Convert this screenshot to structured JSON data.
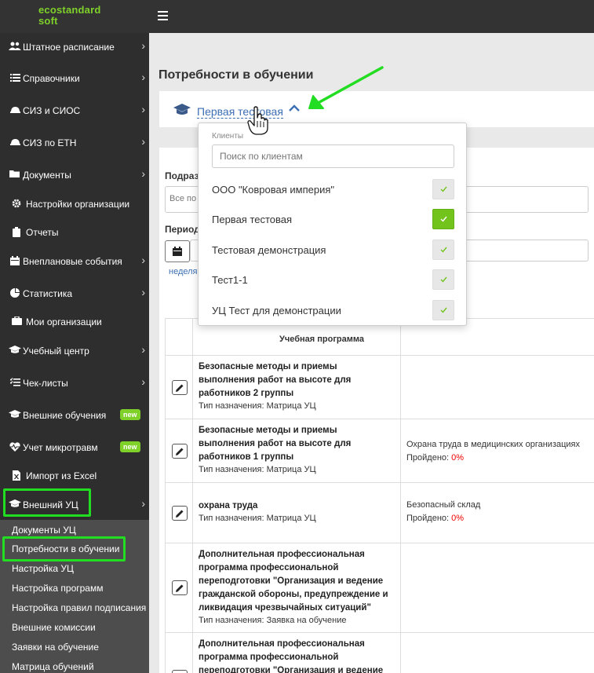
{
  "app": {
    "logo_line1": "ecostandard",
    "logo_line2": "soft"
  },
  "sidebar": {
    "items": [
      {
        "label": "Штатное расписание",
        "icon": "users-icon",
        "chevron": true
      },
      {
        "label": "Справочники",
        "icon": "list-icon",
        "chevron": true
      },
      {
        "label": "СИЗ и СИОС",
        "icon": "hard-hat-icon",
        "chevron": true
      },
      {
        "label": "СИЗ по ЕТН",
        "icon": "hard-hat-icon",
        "chevron": true
      },
      {
        "label": "Документы",
        "icon": "folder-icon",
        "chevron": true
      },
      {
        "label": "Настройки организации",
        "icon": "gear-icon",
        "chevron": false
      },
      {
        "label": "Отчеты",
        "icon": "clipboard-icon",
        "chevron": false
      },
      {
        "label": "Внеплановые события",
        "icon": "calendar-icon",
        "chevron": true
      },
      {
        "label": "Статистика",
        "icon": "pie-chart-icon",
        "chevron": true
      },
      {
        "label": "Мои организации",
        "icon": "briefcase-icon",
        "chevron": false
      },
      {
        "label": "Учебный центр",
        "icon": "graduation-cap-icon",
        "chevron": true
      },
      {
        "label": "Чек-листы",
        "icon": "checklist-icon",
        "chevron": true
      },
      {
        "label": "Внешние обучения",
        "icon": "graduation-cap-icon",
        "badge": "new"
      },
      {
        "label": "Учет микротравм",
        "icon": "heartbeat-icon",
        "badge": "new"
      },
      {
        "label": "Импорт из Excel",
        "icon": "excel-file-icon",
        "chevron": false
      },
      {
        "label": "Внешний УЦ",
        "icon": "graduation-cap-icon",
        "chevron": true
      }
    ],
    "submenu": [
      "Документы УЦ",
      "Потребности в обучении",
      "Настройка УЦ",
      "Настройка программ",
      "Настройка правил подписания",
      "Внешние комиссии",
      "Заявки на обучение",
      "Матрица обучений"
    ]
  },
  "main": {
    "title": "Потребности в обучении",
    "client_selected": "Первая тестовая",
    "form": {
      "subdivision_label": "Подраз",
      "subdivision_value": "Все по",
      "period_label": "Период",
      "week_link": "неделя"
    },
    "table": {
      "header_program": "Учебная программа",
      "rows": [
        {
          "name": "Безопасные методы и приемы выполнения работ на высоте для работников 2 группы",
          "type": "Тип назначения: Матрица УЦ",
          "extra_name": "",
          "extra_passed_label": "",
          "extra_passed_value": ""
        },
        {
          "name": "Безопасные методы и приемы выполнения работ на высоте для работников 1 группы",
          "type": "Тип назначения: Матрица УЦ",
          "extra_name": "Охрана труда в медицинских организациях",
          "extra_passed_label": "Пройдено: ",
          "extra_passed_value": "0%"
        },
        {
          "name": "охрана труда",
          "type": "Тип назначения: Матрица УЦ",
          "extra_name": "Безопасный склад",
          "extra_passed_label": "Пройдено: ",
          "extra_passed_value": "0%"
        },
        {
          "name": "Дополнительная профессиональная программа профессиональной переподготовки \"Организация и ведение гражданской обороны, предупреждение и ликвидация чрезвычайных ситуаций\"",
          "type": "Тип назначения: Заявка на обучение",
          "extra_name": "",
          "extra_passed_label": "",
          "extra_passed_value": ""
        },
        {
          "name": "Дополнительная профессиональная программа профессиональной переподготовки \"Организация и ведение",
          "type": "",
          "extra_name": "",
          "extra_passed_label": "",
          "extra_passed_value": ""
        }
      ]
    }
  },
  "dropdown": {
    "header": "Клиенты",
    "search_placeholder": "Поиск по клиентам",
    "options": [
      {
        "label": "ООО \"Ковровая империя\"",
        "checked": false
      },
      {
        "label": "Первая тестовая",
        "checked": true
      },
      {
        "label": "Тестовая демонстрация",
        "checked": false
      },
      {
        "label": "Тест1-1",
        "checked": false
      },
      {
        "label": "УЦ Тест для демонстрации",
        "checked": false
      }
    ]
  },
  "colors": {
    "accent_green": "#7fd12a",
    "sidebar_bg": "#2e2e2e",
    "highlight": "#22dd22",
    "link_blue": "#3c6fb4"
  }
}
